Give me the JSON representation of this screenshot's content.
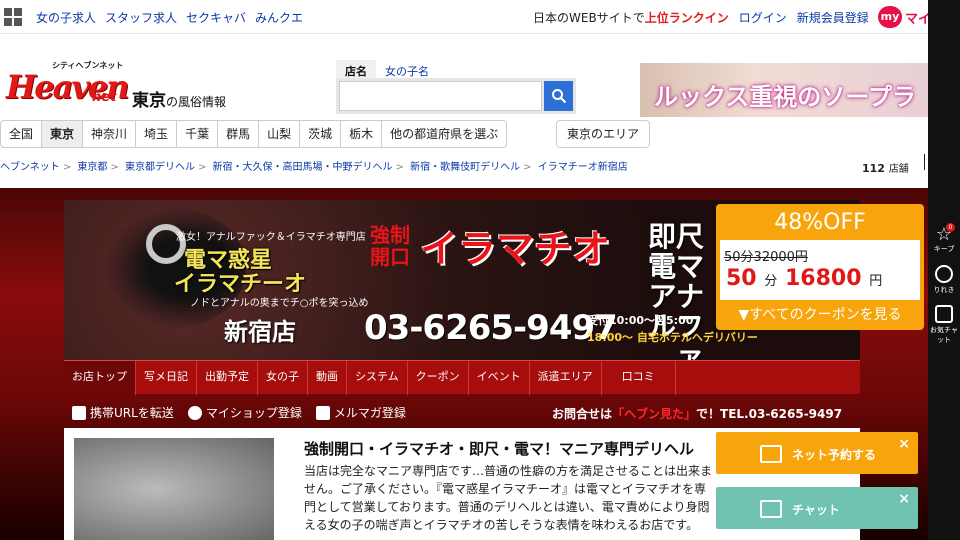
{
  "topbar": {
    "links": [
      "女の子求人",
      "スタッフ求人",
      "セクキャバ",
      "みんクエ"
    ],
    "promo_text": "日本のWEBサイトで",
    "rank_text": "上位ランクイン",
    "login": "ログイン",
    "register": "新規会員登録",
    "my_badge": "my",
    "my_label": "マイ"
  },
  "header": {
    "logo_sub": "シティヘブンネット",
    "logo_main": "Heaven",
    "logo_net": "net",
    "region": "東京",
    "region_suffix": "の風俗情報",
    "search_tabs": [
      "店名",
      "女の子名"
    ],
    "banner_text": "ルックス重視のソープラ"
  },
  "area_nav": {
    "items": [
      "全国",
      "東京",
      "神奈川",
      "埼玉",
      "千葉",
      "群馬",
      "山梨",
      "茨城",
      "栃木",
      "他の都道府県を選ぶ"
    ],
    "extra": "東京のエリア"
  },
  "breadcrumb": [
    "ヘブンネット",
    "東京都",
    "東京都デリヘル",
    "新宿・大久保・高田馬場・中野デリヘル",
    "新宿・歌舞伎町デリヘル",
    "イラマチーオ新宿店"
  ],
  "shop_count": {
    "value": "112",
    "unit": "店舗"
  },
  "shop_banner": {
    "small": "激女！アナルファック＆イラマチオ専門店",
    "name_a": "電マ惑星",
    "name_b": "イラマチーオ",
    "tag": "ノドとアナルの奥までチ○ポを突っ込め",
    "branch": "新宿店",
    "catch_side": "強制開口",
    "catch": "イラマチオ",
    "keywords": "即尺 電マ アナルファ",
    "phone": "03-6265-9497",
    "hours1": "受付10:00～翌5:00",
    "hours2": "18:00～ 自宅ホテルヘデリバリー"
  },
  "coupon": {
    "off": "48%OFF",
    "old": "50分32000円",
    "new_time": "50",
    "new_unit_time": "分",
    "new_price": "16800",
    "new_unit_price": "円",
    "link": "▼すべてのクーポンを見る"
  },
  "shop_nav": [
    "お店トップ",
    "写メ日記",
    "出勤予定",
    "女の子",
    "動画",
    "システム",
    "クーポン",
    "イベント",
    "派遣エリア",
    "口コミ"
  ],
  "actions": [
    "携帯URLを転送",
    "マイショップ登録",
    "メルマガ登録"
  ],
  "inquiry": {
    "prefix": "お問合せは",
    "highlight": "「ヘブン見た」",
    "suffix": "で！TEL.03-6265-9497"
  },
  "content": {
    "title": "強制開口・イラマチオ・即尺・電マ！マニア専門デリヘル",
    "desc": "当店は完全なマニア専門店です…普通の性癖の方を満足させることは出来ません。ご了承ください。『電マ惑星イラマチーオ』は電マとイラマチオを専門として営業しております。普通のデリヘルとは違い、電マ責めにより身悶える女の子の喘ぎ声とイラマチオの苦しそうな表情を味わえるお店です。"
  },
  "float_buttons": {
    "reserve": "ネット予約する",
    "chat": "チャット",
    "close": "×"
  },
  "sidebar": {
    "keep": "キープ",
    "keep_count": "0",
    "history": "りれき",
    "chat": "お気チャット"
  }
}
